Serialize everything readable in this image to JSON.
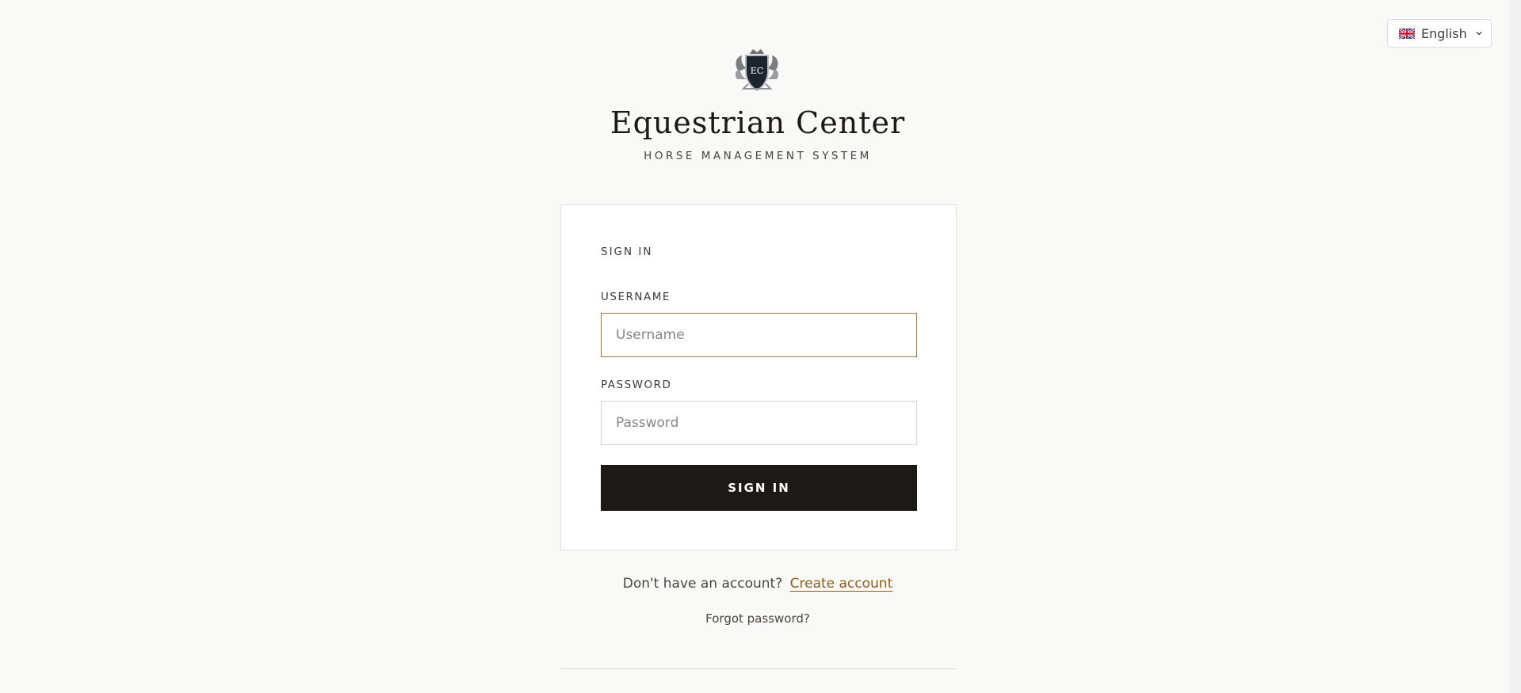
{
  "language": {
    "selected": "English",
    "flag_icon": "uk-flag-icon",
    "chevron_icon": "chevron-down-icon"
  },
  "brand": {
    "crest_icon": "crest-logo-icon",
    "crest_monogram": "EC",
    "title": "Equestrian Center",
    "subtitle": "HORSE MANAGEMENT SYSTEM"
  },
  "form": {
    "heading": "SIGN IN",
    "username_label": "USERNAME",
    "username_placeholder": "Username",
    "username_value": "",
    "password_label": "PASSWORD",
    "password_placeholder": "Password",
    "password_value": "",
    "submit_label": "SIGN IN"
  },
  "footer": {
    "account_prompt": "Don't have an account?",
    "create_account_label": "Create account",
    "forgot_password_label": "Forgot password?"
  },
  "colors": {
    "background": "#f9f9f7",
    "accent": "#a0763d",
    "link": "#8b5e23",
    "button": "#1c1917"
  }
}
